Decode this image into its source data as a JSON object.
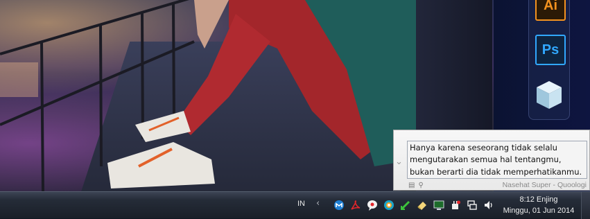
{
  "desktop_dock": {
    "apps": [
      {
        "label": "Ai",
        "icon": "illustrator-icon",
        "accent": "#f3921f"
      },
      {
        "label": "Ps",
        "icon": "photoshop-icon",
        "accent": "#31a8ff"
      },
      {
        "label": "",
        "icon": "cube-app-icon"
      }
    ]
  },
  "tooltip": {
    "text": "Hanya karena seseorang tidak selalu\nmengutarakan semua hal tentangmu,\nbukan berarti dia tidak memperhatikanmu.",
    "source": "Nasehat Super - Quoologi"
  },
  "taskbar": {
    "language": "IN",
    "tray_arrow": "‹",
    "tray_icons": [
      "maxthon-icon",
      "acrobat-icon",
      "chat-bubble-icon",
      "camera-icon",
      "edit-arrow-icon",
      "eraser-icon",
      "monitor-icon",
      "power-plug-icon",
      "network-icon",
      "volume-icon"
    ],
    "clock": {
      "time": "8:12 Enjing",
      "date": "Minggu, 01 Jun 2014"
    }
  }
}
